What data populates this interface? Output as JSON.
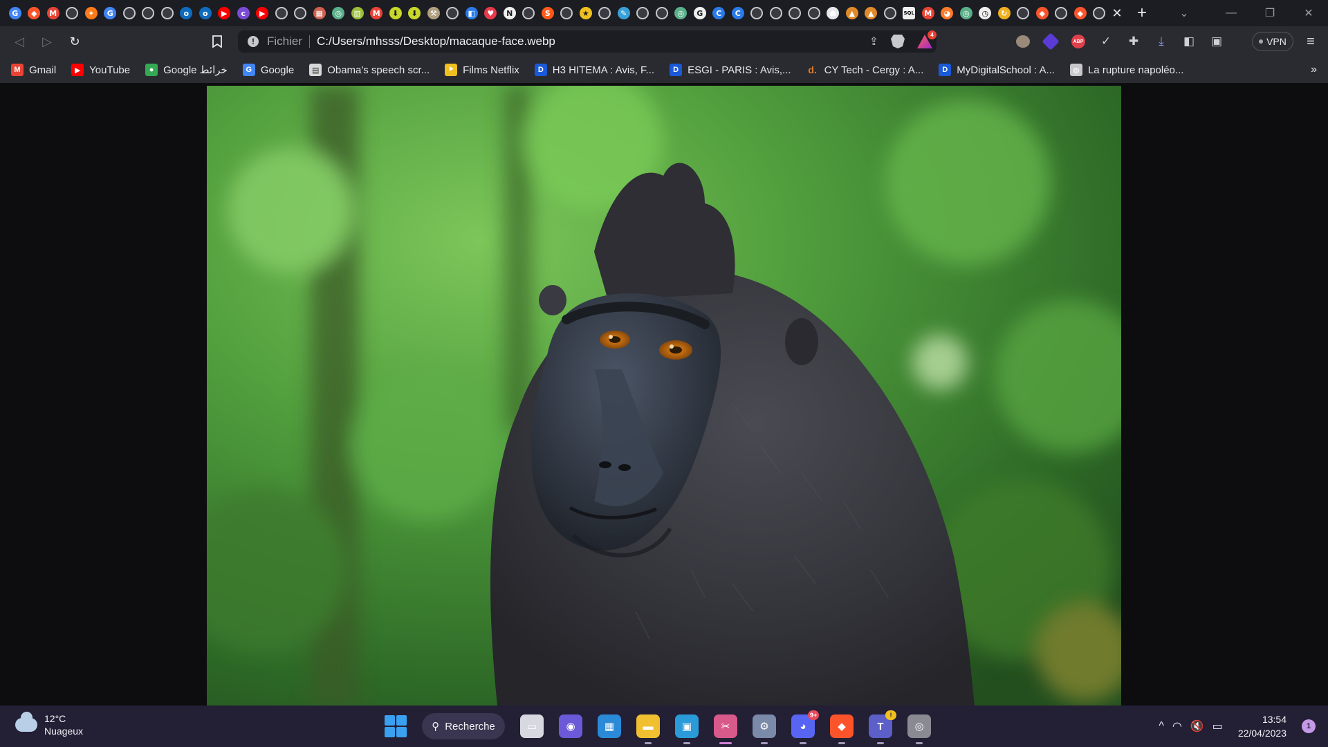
{
  "tabs": {
    "favicons": [
      {
        "icon": "google-g-icon",
        "glyph": "G",
        "color": "#4285f4"
      },
      {
        "icon": "brave-icon",
        "glyph": "◆",
        "color": "#fb542b"
      },
      {
        "icon": "gmail-icon",
        "glyph": "M",
        "color": "#ea4335"
      },
      {
        "icon": "globe-icon",
        "glyph": "",
        "color": "#c8c8cc"
      },
      {
        "icon": "figma-like-icon",
        "glyph": "✦",
        "color": "#ff7a1a"
      },
      {
        "icon": "google-g-icon",
        "glyph": "G",
        "color": "#4285f4"
      },
      {
        "icon": "globe-icon",
        "glyph": "",
        "color": "#c8c8cc"
      },
      {
        "icon": "globe-icon",
        "glyph": "",
        "color": "#c8c8cc"
      },
      {
        "icon": "globe-icon",
        "glyph": "",
        "color": "#c8c8cc"
      },
      {
        "icon": "outlook-icon",
        "glyph": "o",
        "color": "#0f6cbd"
      },
      {
        "icon": "outlook-icon",
        "glyph": "o",
        "color": "#0f6cbd"
      },
      {
        "icon": "youtube-icon",
        "glyph": "▶",
        "color": "#ff0000"
      },
      {
        "icon": "colorlib-icon",
        "glyph": "c",
        "color": "#7a4bd8"
      },
      {
        "icon": "youtube-icon",
        "glyph": "▶",
        "color": "#ff0000"
      },
      {
        "icon": "globe-icon",
        "glyph": "",
        "color": "#c8c8cc"
      },
      {
        "icon": "globe-icon",
        "glyph": "",
        "color": "#c8c8cc"
      },
      {
        "icon": "store-icon",
        "glyph": "▦",
        "color": "#d06050"
      },
      {
        "icon": "green-app-icon",
        "glyph": "◎",
        "color": "#5ab08a"
      },
      {
        "icon": "chart-app-icon",
        "glyph": "▥",
        "color": "#9abf3a"
      },
      {
        "icon": "gmail-icon",
        "glyph": "M",
        "color": "#ea4335"
      },
      {
        "icon": "download-icon",
        "glyph": "⬇",
        "color": "#c8d82a"
      },
      {
        "icon": "download-icon",
        "glyph": "⬇",
        "color": "#c8d82a"
      },
      {
        "icon": "tools-icon",
        "glyph": "⚒",
        "color": "#b0a080"
      },
      {
        "icon": "globe-icon",
        "glyph": "",
        "color": "#c8c8cc"
      },
      {
        "icon": "dropbox-icon",
        "glyph": "◧",
        "color": "#2a7ae8"
      },
      {
        "icon": "heart-icon",
        "glyph": "♥",
        "color": "#e83a4a"
      },
      {
        "icon": "notion-icon",
        "glyph": "N",
        "color": "#f0f0f0"
      },
      {
        "icon": "globe-icon",
        "glyph": "",
        "color": "#c8c8cc"
      },
      {
        "icon": "s-icon",
        "glyph": "S",
        "color": "#ff5a1a"
      },
      {
        "icon": "globe-icon",
        "glyph": "",
        "color": "#c8c8cc"
      },
      {
        "icon": "star-icon",
        "glyph": "★",
        "color": "#f0c020"
      },
      {
        "icon": "globe-icon",
        "glyph": "",
        "color": "#c8c8cc"
      },
      {
        "icon": "script-icon",
        "glyph": "✎",
        "color": "#3aa0d8"
      },
      {
        "icon": "globe-icon",
        "glyph": "",
        "color": "#c8c8cc"
      },
      {
        "icon": "globe-icon",
        "glyph": "",
        "color": "#c8c8cc"
      },
      {
        "icon": "green-app-icon",
        "glyph": "◎",
        "color": "#5ab08a"
      },
      {
        "icon": "google-g-icon",
        "glyph": "G",
        "color": "#f0f0f0"
      },
      {
        "icon": "c-icon",
        "glyph": "C",
        "color": "#2a7ae8"
      },
      {
        "icon": "c-icon",
        "glyph": "C",
        "color": "#2a7ae8"
      },
      {
        "icon": "globe-icon",
        "glyph": "",
        "color": "#c8c8cc"
      },
      {
        "icon": "globe-icon",
        "glyph": "",
        "color": "#c8c8cc"
      },
      {
        "icon": "globe-icon",
        "glyph": "",
        "color": "#c8c8cc"
      },
      {
        "icon": "globe-icon",
        "glyph": "",
        "color": "#c8c8cc"
      },
      {
        "icon": "ghost-icon",
        "glyph": "☗",
        "color": "#e8e8ec"
      },
      {
        "icon": "mountain-icon",
        "glyph": "▲",
        "color": "#e08a2a"
      },
      {
        "icon": "mountain-icon",
        "glyph": "▲",
        "color": "#e08a2a"
      },
      {
        "icon": "globe-icon",
        "glyph": "",
        "color": "#c8c8cc"
      },
      {
        "icon": "sql-icon",
        "glyph": "SQL",
        "color": "#f0f0f0"
      },
      {
        "icon": "gmail-icon",
        "glyph": "M",
        "color": "#ea4335"
      },
      {
        "icon": "fox-icon",
        "glyph": "◕",
        "color": "#ff7a2a"
      },
      {
        "icon": "green-app-icon",
        "glyph": "◎",
        "color": "#5ab08a"
      },
      {
        "icon": "clock-icon",
        "glyph": "◷",
        "color": "#f0f0f0"
      },
      {
        "icon": "refresh-app-icon",
        "glyph": "↻",
        "color": "#f0b020"
      },
      {
        "icon": "globe-icon",
        "glyph": "",
        "color": "#c8c8cc"
      },
      {
        "icon": "brave-icon",
        "glyph": "◆",
        "color": "#fb542b"
      },
      {
        "icon": "globe-icon",
        "glyph": "",
        "color": "#c8c8cc"
      },
      {
        "icon": "brave-icon",
        "glyph": "◆",
        "color": "#fb542b"
      },
      {
        "icon": "globe-icon",
        "glyph": "",
        "color": "#c8c8cc"
      }
    ],
    "close_glyph": "✕",
    "new_tab_glyph": "+"
  },
  "window": {
    "tab_search_glyph": "⌄",
    "minimize_glyph": "—",
    "restore_glyph": "❐",
    "close_glyph": "✕"
  },
  "toolbar": {
    "back_glyph": "◁",
    "forward_glyph": "▷",
    "reload_glyph": "↻",
    "bookmark_glyph": "🔖",
    "scheme": "Fichier",
    "url": "C:/Users/mhsss/Desktop/macaque-face.webp",
    "share_glyph": "⇪",
    "rewards_badge": "4",
    "vpn_label": "VPN",
    "menu_glyph": "≡",
    "ext_abp": "ABP",
    "ext_check": "✓",
    "ext_puzzle": "✚",
    "ext_download": "⤓",
    "ext_sidebar": "◧",
    "ext_wallet": "▣"
  },
  "bookmarks": {
    "items": [
      {
        "label": "Gmail",
        "glyph": "M",
        "color": "#ea4335"
      },
      {
        "label": "YouTube",
        "glyph": "▶",
        "color": "#ff0000"
      },
      {
        "label": "Google خرائط",
        "glyph": "●",
        "color": "#34a853"
      },
      {
        "label": "Google",
        "glyph": "G",
        "color": "#4285f4"
      },
      {
        "label": "Obama's speech scr...",
        "glyph": "▤",
        "color": "#d8d8d8"
      },
      {
        "label": "Films Netflix",
        "glyph": "⯈",
        "color": "#f0c020"
      },
      {
        "label": "H3 HITEMA : Avis, F...",
        "glyph": "D",
        "color": "#1a5ad8"
      },
      {
        "label": "ESGI - PARIS : Avis,...",
        "glyph": "D",
        "color": "#1a5ad8"
      },
      {
        "label": "CY Tech - Cergy : A...",
        "glyph": "d.",
        "color": "#e07a2a"
      },
      {
        "label": "MyDigitalSchool : A...",
        "glyph": "D",
        "color": "#1a5ad8"
      },
      {
        "label": "La rupture napoléo...",
        "glyph": "◍",
        "color": "#c8c8cc"
      }
    ],
    "more_glyph": "»"
  },
  "taskbar": {
    "weather_temp": "12°C",
    "weather_desc": "Nuageux",
    "search_label": "Recherche",
    "search_glyph": "⚲",
    "apps": [
      {
        "name": "taskview",
        "glyph": "▭",
        "color": "#d8d8e0",
        "running": false
      },
      {
        "name": "teams-chat",
        "glyph": "◉",
        "color": "#6a5ad8",
        "running": false
      },
      {
        "name": "microsoft-store",
        "glyph": "▦",
        "color": "#2a8ad8",
        "running": false
      },
      {
        "name": "file-explorer",
        "glyph": "▬",
        "color": "#f0c030",
        "running": true
      },
      {
        "name": "remote-desktop",
        "glyph": "▣",
        "color": "#2a9ad8",
        "running": true
      },
      {
        "name": "snipping-tool",
        "glyph": "✂",
        "color": "#d85a8a",
        "running": true,
        "active": true
      },
      {
        "name": "settings",
        "glyph": "⚙",
        "color": "#7a8aa8",
        "running": true
      },
      {
        "name": "discord",
        "glyph": "◕",
        "color": "#5865f2",
        "running": true,
        "badge": "9+"
      },
      {
        "name": "brave-browser",
        "glyph": "◆",
        "color": "#fb542b",
        "running": true
      },
      {
        "name": "teams",
        "glyph": "T",
        "color": "#5b5fc7",
        "running": true,
        "badge": "!"
      },
      {
        "name": "github-desktop",
        "glyph": "◎",
        "color": "#8a8a92",
        "running": true
      }
    ],
    "tray": {
      "chevron_glyph": "^",
      "wifi_glyph": "◠",
      "sound_glyph": "🔇",
      "battery_glyph": "▭"
    },
    "time": "13:54",
    "date": "22/04/2023",
    "notification_count": "1"
  }
}
